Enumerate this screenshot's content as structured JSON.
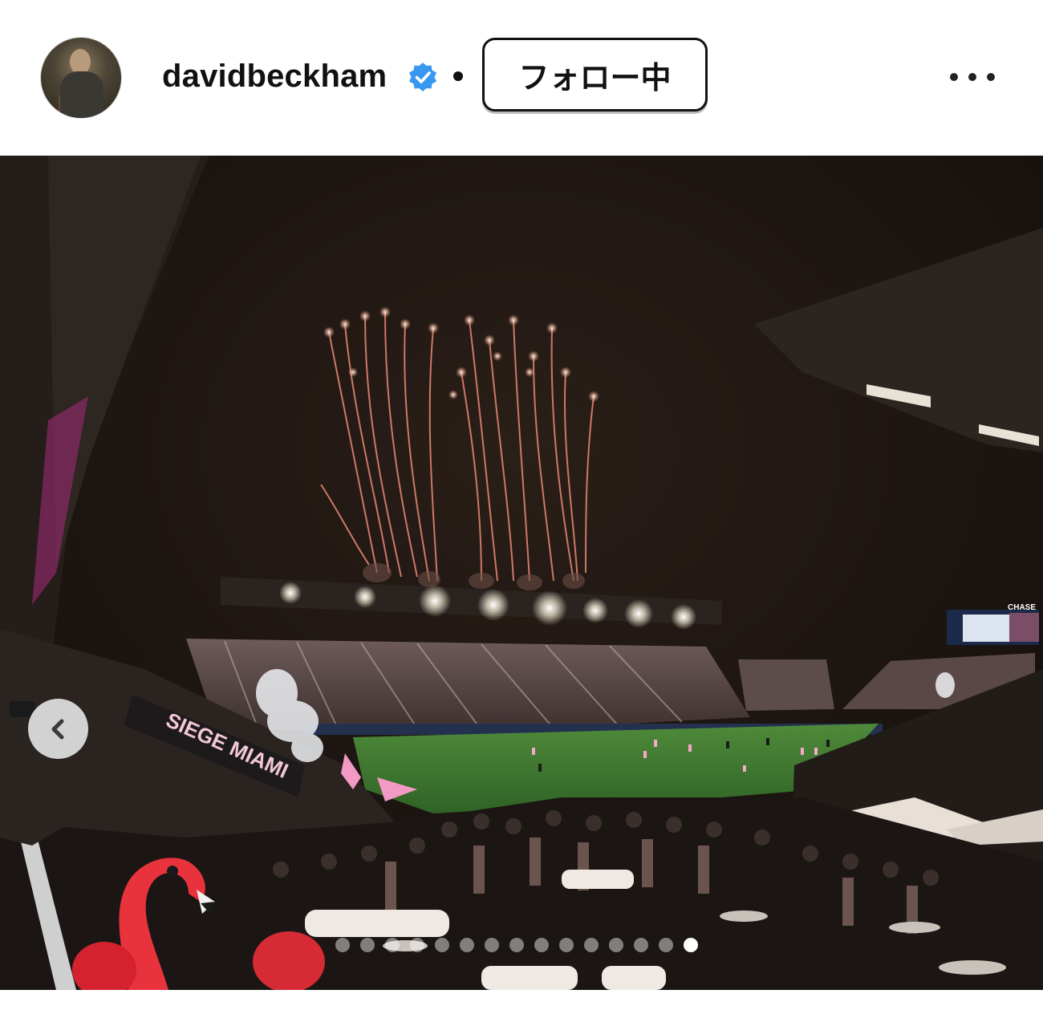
{
  "post_header": {
    "username": "davidbeckham",
    "verified": true,
    "separator": "•",
    "follow_button_label": "フォロー中",
    "more_options_icon": "more-horizontal-icon",
    "verified_icon": "verified-badge-icon",
    "verified_color": "#3897f0"
  },
  "photo": {
    "banner_text": "SIEGE MIAMI",
    "sponsor_text": "CHASE",
    "previous_icon": "chevron-left-icon"
  },
  "carousel": {
    "total_slides": 15,
    "active_slide": 15
  }
}
